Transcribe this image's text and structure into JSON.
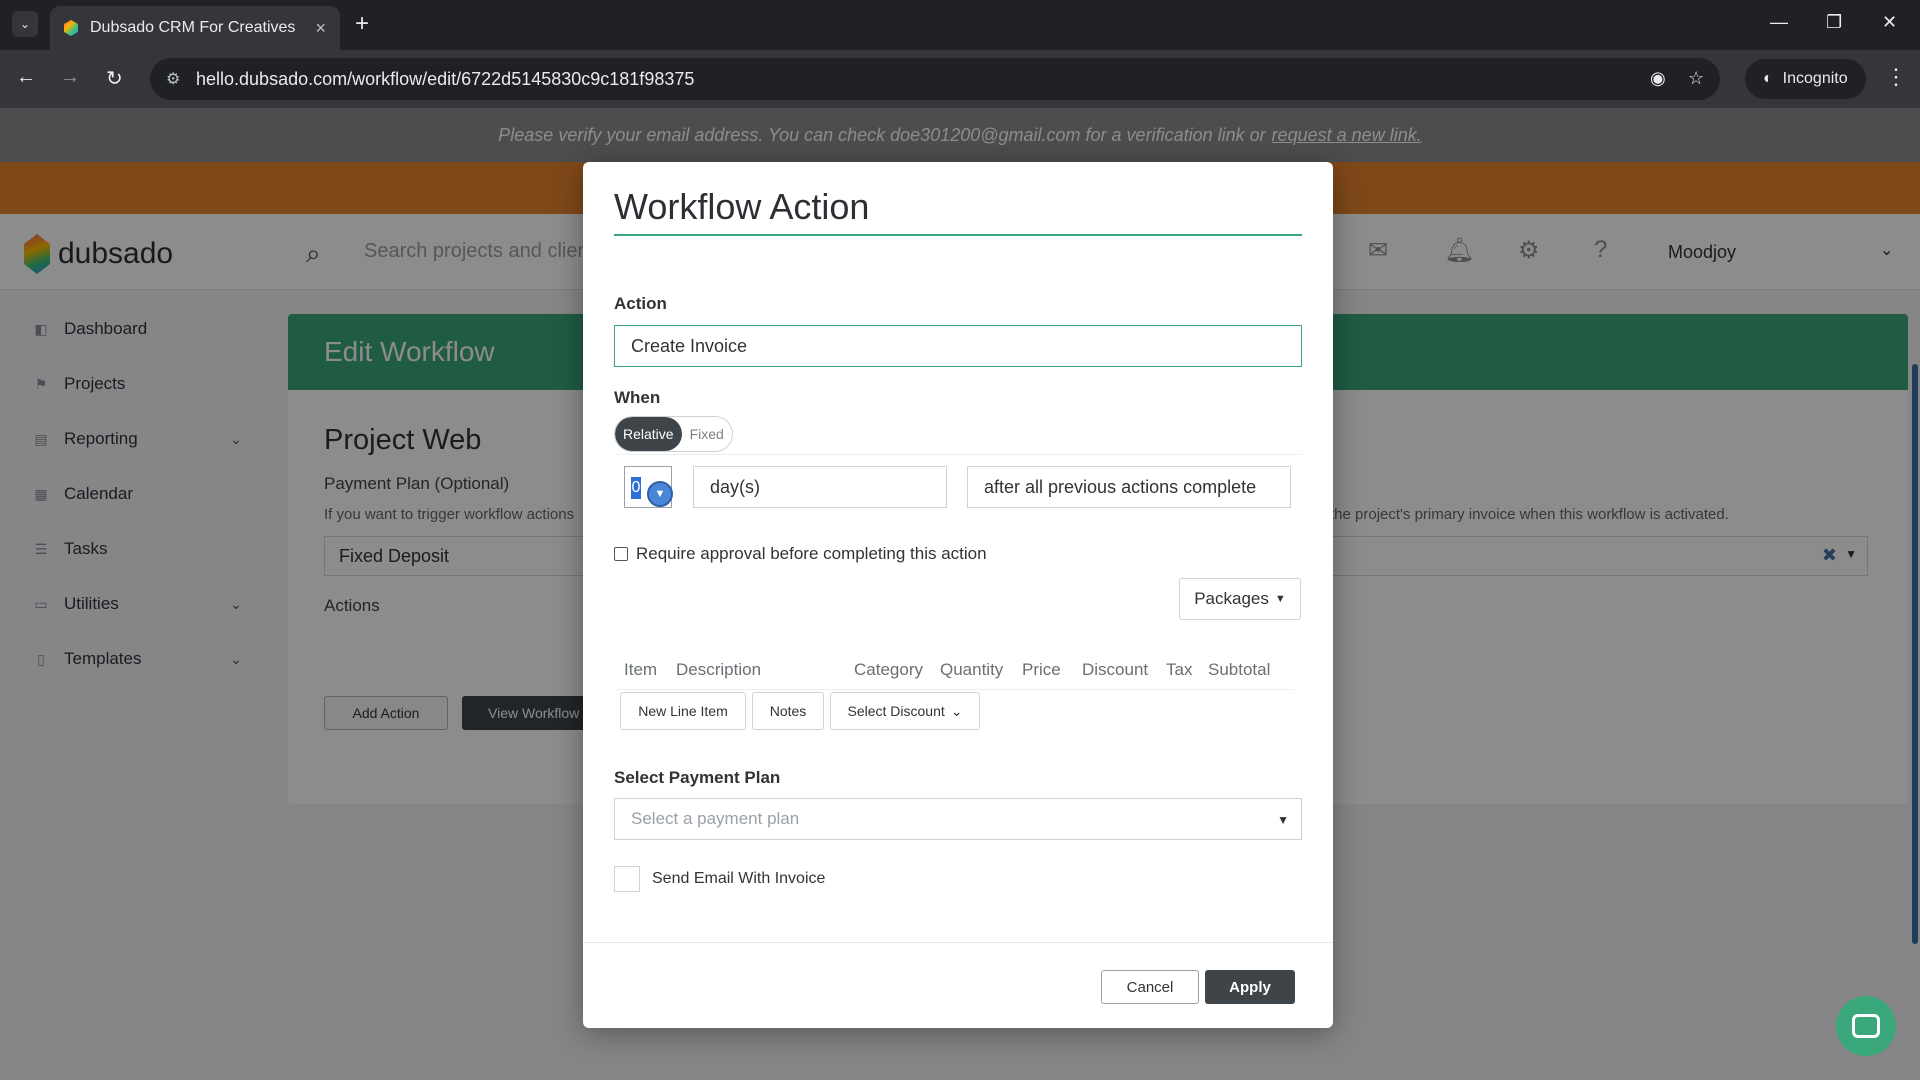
{
  "browser": {
    "tab_title": "Dubsado CRM For Creatives",
    "url": "hello.dubsado.com/workflow/edit/6722d5145830c9c181f98375",
    "incognito_label": "Incognito"
  },
  "banner": {
    "text": "Please verify your email address. You can check doe301200@gmail.com for a verification link or",
    "link": "request a new link."
  },
  "header": {
    "logo": "dubsado",
    "search_placeholder": "Search projects and clients",
    "user": "Moodjoy"
  },
  "sidebar": {
    "items": [
      {
        "label": "Dashboard",
        "icon": "dashboard-icon"
      },
      {
        "label": "Projects",
        "icon": "projects-icon"
      },
      {
        "label": "Reporting",
        "icon": "reporting-icon",
        "expandable": true
      },
      {
        "label": "Calendar",
        "icon": "calendar-icon"
      },
      {
        "label": "Tasks",
        "icon": "tasks-icon"
      },
      {
        "label": "Utilities",
        "icon": "utilities-icon",
        "expandable": true
      },
      {
        "label": "Templates",
        "icon": "templates-icon",
        "expandable": true
      }
    ]
  },
  "content": {
    "header": "Edit Workflow",
    "project_title": "Project Web",
    "payment_plan_label": "Payment Plan (Optional)",
    "payment_plan_help_left": "If you want to trigger workflow actions",
    "payment_plan_help_right": "the project's primary invoice when this workflow is activated.",
    "payment_plan_value": "Fixed Deposit",
    "actions_label": "Actions",
    "add_action": "Add Action",
    "view_workflow": "View Workflow"
  },
  "modal": {
    "title": "Workflow Action",
    "action_label": "Action",
    "action_value": "Create Invoice",
    "when_label": "When",
    "toggle_relative": "Relative",
    "toggle_fixed": "Fixed",
    "number_value": "0",
    "unit_value": "day(s)",
    "timing_value": "after all previous actions complete",
    "approval_label": "Require approval before completing this action",
    "packages_button": "Packages",
    "columns": [
      "Item",
      "Description",
      "Category",
      "Quantity",
      "Price",
      "Discount",
      "Tax",
      "Subtotal"
    ],
    "new_line_item": "New Line Item",
    "notes": "Notes",
    "select_discount": "Select Discount",
    "payment_plan_label": "Select Payment Plan",
    "payment_plan_placeholder": "Select a payment plan",
    "send_email_label": "Send Email With Invoice",
    "cancel": "Cancel",
    "apply": "Apply"
  }
}
